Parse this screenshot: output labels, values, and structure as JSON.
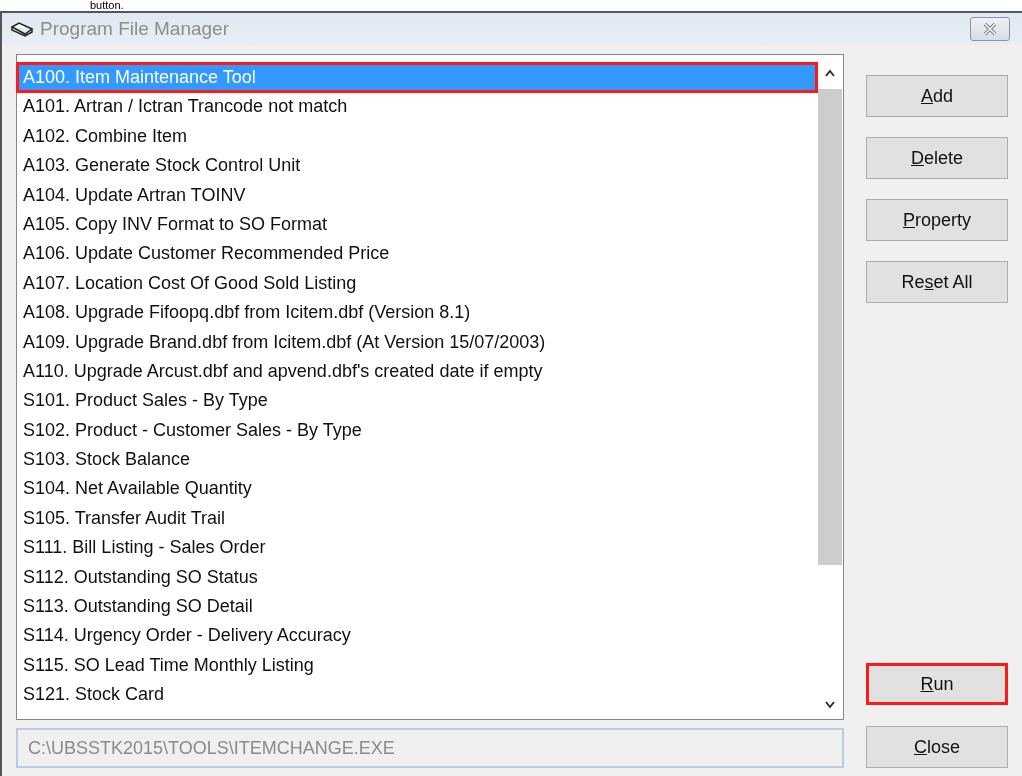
{
  "caption_fragment": "button.",
  "window": {
    "title": "Program File Manager"
  },
  "programs": [
    {
      "label": "A100. Item Maintenance Tool",
      "selected": true,
      "highlighted": true
    },
    {
      "label": "A101. Artran / Ictran Trancode not match",
      "selected": false,
      "highlighted": false
    },
    {
      "label": "A102. Combine Item",
      "selected": false,
      "highlighted": false
    },
    {
      "label": "A103. Generate Stock Control Unit",
      "selected": false,
      "highlighted": false
    },
    {
      "label": "A104. Update Artran TOINV",
      "selected": false,
      "highlighted": false
    },
    {
      "label": "A105. Copy INV Format to SO Format",
      "selected": false,
      "highlighted": false
    },
    {
      "label": "A106. Update Customer Recommended Price",
      "selected": false,
      "highlighted": false
    },
    {
      "label": "A107. Location Cost Of Good Sold Listing",
      "selected": false,
      "highlighted": false
    },
    {
      "label": "A108. Upgrade Fifoopq.dbf from Icitem.dbf (Version 8.1)",
      "selected": false,
      "highlighted": false
    },
    {
      "label": "A109. Upgrade Brand.dbf from Icitem.dbf (At Version 15/07/2003)",
      "selected": false,
      "highlighted": false
    },
    {
      "label": "A110. Upgrade Arcust.dbf and apvend.dbf's created date if empty",
      "selected": false,
      "highlighted": false
    },
    {
      "label": "S101. Product Sales - By Type",
      "selected": false,
      "highlighted": false
    },
    {
      "label": "S102. Product - Customer Sales - By Type",
      "selected": false,
      "highlighted": false
    },
    {
      "label": "S103. Stock Balance",
      "selected": false,
      "highlighted": false
    },
    {
      "label": "S104. Net Available Quantity",
      "selected": false,
      "highlighted": false
    },
    {
      "label": "S105. Transfer Audit Trail",
      "selected": false,
      "highlighted": false
    },
    {
      "label": "S111. Bill Listing - Sales Order",
      "selected": false,
      "highlighted": false
    },
    {
      "label": "S112. Outstanding SO Status",
      "selected": false,
      "highlighted": false
    },
    {
      "label": "S113. Outstanding SO Detail",
      "selected": false,
      "highlighted": false
    },
    {
      "label": "S114. Urgency Order - Delivery Accuracy",
      "selected": false,
      "highlighted": false
    },
    {
      "label": "S115. SO Lead Time Monthly Listing",
      "selected": false,
      "highlighted": false
    },
    {
      "label": "S121. Stock Card",
      "selected": false,
      "highlighted": false
    }
  ],
  "path_field": {
    "value": "C:\\UBSSTK2015\\TOOLS\\ITEMCHANGE.EXE",
    "disabled": true
  },
  "top_buttons": [
    {
      "access_key": "A",
      "rest": "dd",
      "highlighted": false
    },
    {
      "access_key": "D",
      "rest": "elete",
      "highlighted": false
    },
    {
      "access_key": "P",
      "rest": "roperty",
      "highlighted": false
    },
    {
      "lead": "Re",
      "access_key": "s",
      "rest": "et All",
      "highlighted": false
    }
  ],
  "bottom_buttons": [
    {
      "access_key": "R",
      "rest": "un",
      "highlighted": true
    },
    {
      "access_key": "C",
      "rest": "lose",
      "highlighted": false
    }
  ]
}
